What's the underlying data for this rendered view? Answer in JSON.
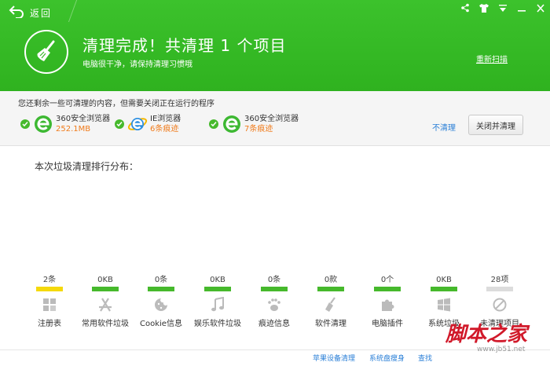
{
  "header": {
    "back_label": "返回",
    "title": "清理完成！共清理 1 个项目",
    "subtitle": "电脑很干净，请保持清理习惯哦",
    "rescan_label": "重新扫描",
    "accent_color": "#35b925"
  },
  "window_controls": [
    "share-icon",
    "skin-icon",
    "menu-icon",
    "minimize-icon",
    "close-icon"
  ],
  "notice": {
    "text": "您还剩余一些可清理的内容，但需要关闭正在运行的程序",
    "browsers": [
      {
        "name": "360安全浏览器",
        "detail": "252.1MB",
        "icon": "browser-360-icon"
      },
      {
        "name": "IE浏览器",
        "detail": "6条痕迹",
        "icon": "browser-ie-icon"
      },
      {
        "name": "360安全浏览器",
        "detail": "7条痕迹",
        "icon": "browser-360-icon"
      }
    ],
    "no_clean_label": "不清理",
    "close_clean_label": "关闭并清理"
  },
  "main": {
    "section_title": "本次垃圾清理排行分布：",
    "categories": [
      {
        "label": "注册表",
        "value": "2条",
        "bar_color": "#f5d90a",
        "icon": "registry-icon"
      },
      {
        "label": "常用软件垃圾",
        "value": "0KB",
        "bar_color": "#46b92c",
        "icon": "app-store-icon"
      },
      {
        "label": "Cookie信息",
        "value": "0条",
        "bar_color": "#46b92c",
        "icon": "cookie-icon"
      },
      {
        "label": "娱乐软件垃圾",
        "value": "0KB",
        "bar_color": "#46b92c",
        "icon": "music-icon"
      },
      {
        "label": "痕迹信息",
        "value": "0条",
        "bar_color": "#46b92c",
        "icon": "footprint-icon"
      },
      {
        "label": "软件清理",
        "value": "0款",
        "bar_color": "#46b92c",
        "icon": "broom-icon"
      },
      {
        "label": "电脑插件",
        "value": "0个",
        "bar_color": "#46b92c",
        "icon": "plugin-icon"
      },
      {
        "label": "系统垃圾",
        "value": "0KB",
        "bar_color": "#46b92c",
        "icon": "windows-icon"
      },
      {
        "label": "未清理项目",
        "value": "28项",
        "bar_color": "#dcdcdc",
        "icon": "forbidden-icon"
      }
    ]
  },
  "footer": {
    "links": [
      "苹果设备清理",
      "系统盘瘦身",
      "查找"
    ]
  },
  "watermark": {
    "main": "脚本之家",
    "url": "www.jb51.net"
  }
}
